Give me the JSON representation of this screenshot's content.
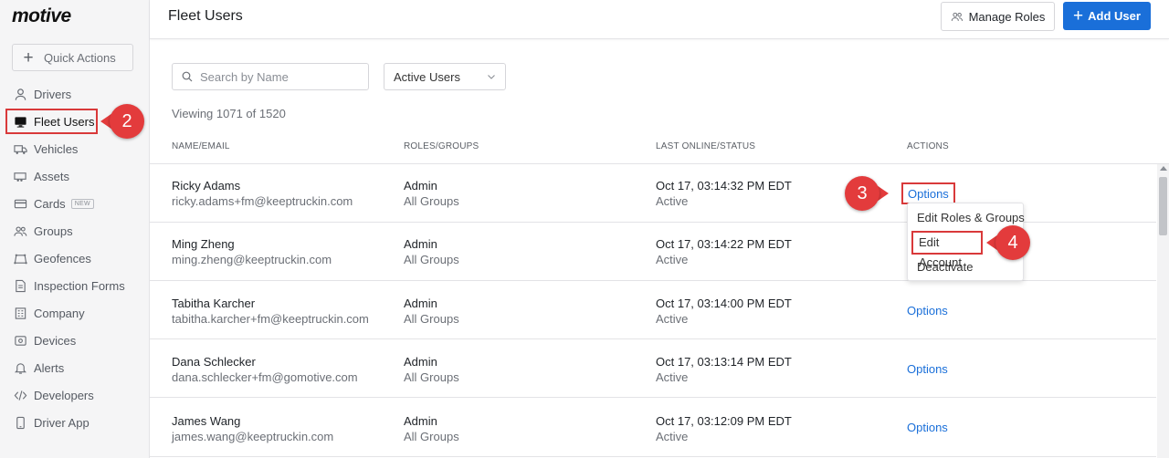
{
  "brand": {
    "logo": "motive"
  },
  "sidebar": {
    "quick_actions": "Quick Actions",
    "items": [
      {
        "label": "Drivers",
        "icon": "person-icon"
      },
      {
        "label": "Fleet Users",
        "icon": "monitor-icon",
        "active": true
      },
      {
        "label": "Vehicles",
        "icon": "truck-icon"
      },
      {
        "label": "Assets",
        "icon": "trailer-icon"
      },
      {
        "label": "Cards",
        "icon": "card-icon",
        "badge": "NEW"
      },
      {
        "label": "Groups",
        "icon": "people-icon"
      },
      {
        "label": "Geofences",
        "icon": "geofence-icon"
      },
      {
        "label": "Inspection Forms",
        "icon": "document-icon"
      },
      {
        "label": "Company",
        "icon": "building-icon"
      },
      {
        "label": "Devices",
        "icon": "device-icon"
      },
      {
        "label": "Alerts",
        "icon": "bell-icon"
      },
      {
        "label": "Developers",
        "icon": "code-icon"
      },
      {
        "label": "Driver App",
        "icon": "phone-icon"
      }
    ]
  },
  "header": {
    "title": "Fleet Users",
    "manage_roles": "Manage Roles",
    "add_user": "Add User"
  },
  "filters": {
    "search_placeholder": "Search by Name",
    "status_selected": "Active Users"
  },
  "viewing": "Viewing 1071 of 1520",
  "table": {
    "columns": [
      "NAME/EMAIL",
      "ROLES/GROUPS",
      "LAST ONLINE/STATUS",
      "ACTIONS"
    ],
    "rows": [
      {
        "name": "Ricky Adams",
        "email": "ricky.adams+fm@keeptruckin.com",
        "role": "Admin",
        "groups": "All Groups",
        "last_online": "Oct 17, 03:14:32 PM EDT",
        "status": "Active",
        "action": "Options"
      },
      {
        "name": "Ming Zheng",
        "email": "ming.zheng@keeptruckin.com",
        "role": "Admin",
        "groups": "All Groups",
        "last_online": "Oct 17, 03:14:22 PM EDT",
        "status": "Active",
        "action": "Options"
      },
      {
        "name": "Tabitha Karcher",
        "email": "tabitha.karcher+fm@keeptruckin.com",
        "role": "Admin",
        "groups": "All Groups",
        "last_online": "Oct 17, 03:14:00 PM EDT",
        "status": "Active",
        "action": "Options"
      },
      {
        "name": "Dana Schlecker",
        "email": "dana.schlecker+fm@gomotive.com",
        "role": "Admin",
        "groups": "All Groups",
        "last_online": "Oct 17, 03:13:14 PM EDT",
        "status": "Active",
        "action": "Options"
      },
      {
        "name": "James Wang",
        "email": "james.wang@keeptruckin.com",
        "role": "Admin",
        "groups": "All Groups",
        "last_online": "Oct 17, 03:12:09 PM EDT",
        "status": "Active",
        "action": "Options"
      }
    ]
  },
  "dropdown": {
    "items": [
      "Edit Roles & Groups",
      "Edit Account",
      "Deactivate"
    ]
  },
  "callouts": [
    "2",
    "3",
    "4"
  ],
  "colors": {
    "accent": "#1a6fd9",
    "annotation": "#e33b3c"
  }
}
